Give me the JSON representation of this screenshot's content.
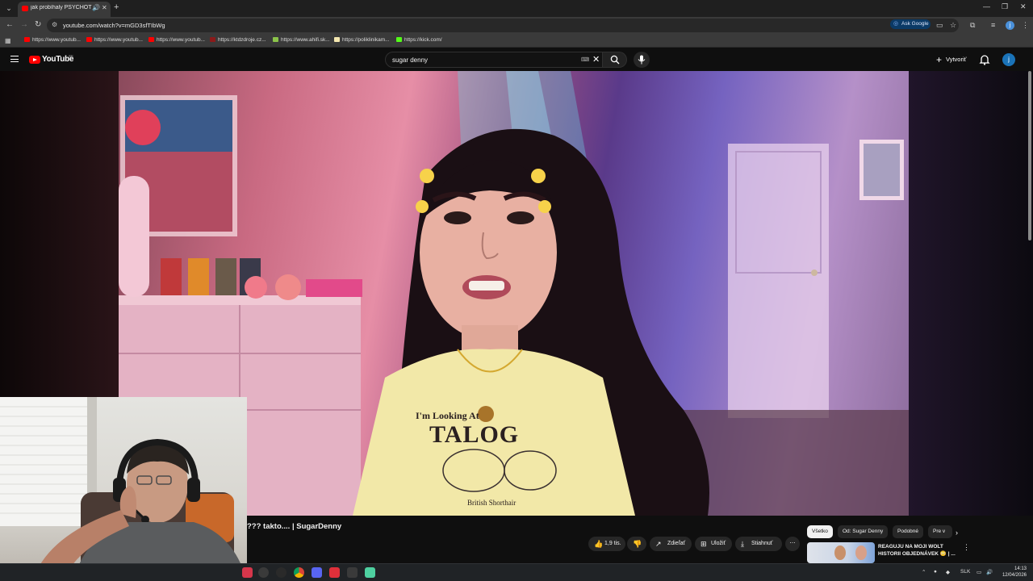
{
  "browser": {
    "tab_title": "jak probíhaly PSYCHOTESTY",
    "url": "youtube.com/watch?v=mGD3sfTIbWg",
    "ask_google": "Ask Google",
    "profile_initial": "j",
    "bookmarks": [
      {
        "label": "https://www.youtub...",
        "color": "#ff0000"
      },
      {
        "label": "https://www.youtub...",
        "color": "#ff0000"
      },
      {
        "label": "https://www.youtub...",
        "color": "#ff0000"
      },
      {
        "label": "https://ktdzdroje.cz...",
        "color": "#8b1a1a"
      },
      {
        "label": "https://www.ahifi.sk...",
        "color": "#8bc34a"
      },
      {
        "label": "https://poliklinikam...",
        "color": "#f5e8b0"
      },
      {
        "label": "https://kick.com/",
        "color": "#53fc18"
      }
    ]
  },
  "youtube": {
    "logo_text": "YouTube",
    "country": "SK",
    "search_query": "sugar denny",
    "create_label": "Vytvoriť",
    "avatar_initial": "j",
    "video_title": "??? takto.... | SugarDenny",
    "likes": "1,9 tis.",
    "share_label": "Zdieľať",
    "save_label": "Uložiť",
    "download_label": "Stiahnuť",
    "chips": [
      "Všetko",
      "Od: Sugar Denny",
      "Podobné",
      "Pre v"
    ],
    "recommendation_title": "REAGUJU NA MOJI WOLT HISTORII OBJEDNÁVEK 😳 | ..."
  },
  "video_frame": {
    "shirt_text": "I'm Looking At",
    "shirt_big": "TALOG",
    "shirt_caption": "British Shorthair"
  },
  "taskbar": {
    "language": "SLK",
    "time": "14:13",
    "date": "12/04/2026"
  }
}
